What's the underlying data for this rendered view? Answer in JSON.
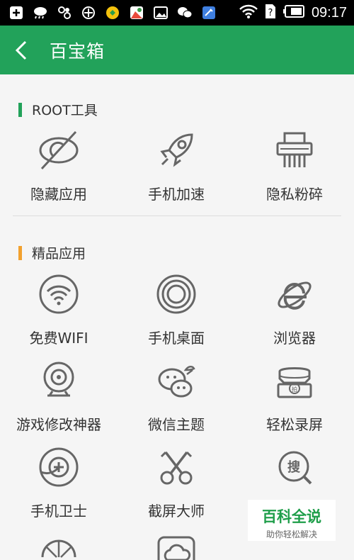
{
  "status": {
    "time": "09:17"
  },
  "appbar": {
    "title": "百宝箱"
  },
  "sections": [
    {
      "title": "ROOT工具",
      "color": "#22a25a",
      "items": [
        {
          "label": "隐藏应用",
          "icon": "hidden-eye-icon"
        },
        {
          "label": "手机加速",
          "icon": "rocket-icon"
        },
        {
          "label": "隐私粉碎",
          "icon": "shredder-icon"
        }
      ]
    },
    {
      "title": "精品应用",
      "color": "#f2a12e",
      "items": [
        {
          "label": "免费WIFI",
          "icon": "wifi-icon"
        },
        {
          "label": "手机桌面",
          "icon": "desktop-rings-icon"
        },
        {
          "label": "浏览器",
          "icon": "browser-icon"
        },
        {
          "label": "游戏修改神器",
          "icon": "webcam-icon"
        },
        {
          "label": "微信主题",
          "icon": "wechat-theme-icon"
        },
        {
          "label": "轻松录屏",
          "icon": "screen-record-icon"
        },
        {
          "label": "手机卫士",
          "icon": "guard-icon"
        },
        {
          "label": "截屏大师",
          "icon": "scissors-icon"
        },
        {
          "label": "",
          "icon": "search-sou-icon"
        },
        {
          "label": "",
          "icon": "shell-icon"
        },
        {
          "label": "",
          "icon": "cloud-icon"
        }
      ]
    }
  ],
  "watermark": {
    "main": "百科全说",
    "sub": "助你轻松解决"
  }
}
